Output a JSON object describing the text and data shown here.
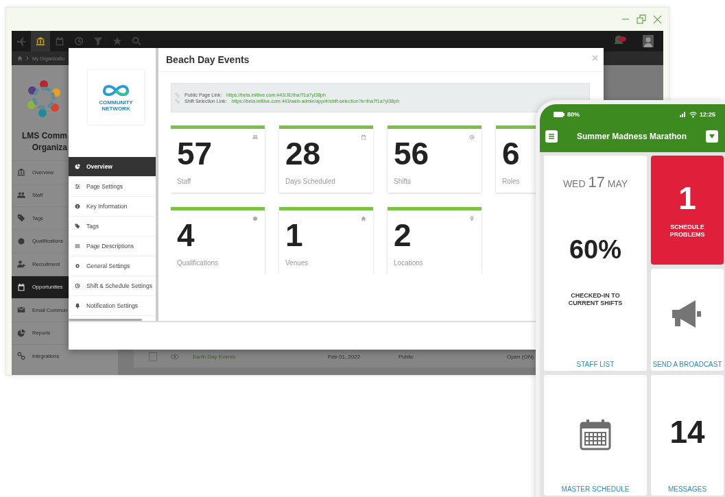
{
  "top_bar": {
    "icons": [
      {
        "kind": "plane",
        "selected": false
      },
      {
        "kind": "bank",
        "selected": true
      },
      {
        "kind": "calendar",
        "selected": false
      },
      {
        "kind": "clock",
        "selected": false
      },
      {
        "kind": "filter",
        "selected": false
      },
      {
        "kind": "star",
        "selected": false
      },
      {
        "kind": "search",
        "selected": false
      }
    ]
  },
  "breadcrumb": {
    "current": "My Organizatio"
  },
  "sidebar": {
    "org_name": [
      "LMS Comm",
      "Organiza"
    ],
    "items": [
      {
        "label": "Overview",
        "kind": "bank",
        "selected": false
      },
      {
        "label": "Staff",
        "kind": "people",
        "selected": false
      },
      {
        "label": "Tags",
        "kind": "tag",
        "selected": false
      },
      {
        "label": "Qualifications",
        "kind": "dot",
        "selected": false
      },
      {
        "label": "Recruitment",
        "kind": "person-add",
        "selected": false
      },
      {
        "label": "Opportunities",
        "kind": "calendar",
        "selected": true
      },
      {
        "label": "Email Commun",
        "kind": "mail",
        "selected": false
      },
      {
        "label": "Reports",
        "kind": "pie",
        "selected": false
      },
      {
        "label": "Integrations",
        "kind": "link",
        "selected": false
      }
    ]
  },
  "table": {
    "rows": [
      {
        "checked": false,
        "name": "Earth Day Events",
        "date": "Feb 01, 2022",
        "visibility": "Public",
        "status": "Open (ON)"
      }
    ]
  },
  "modal": {
    "title": "Beach Day Events",
    "logo_text": "COMMUNITY NETWORK",
    "nav": [
      {
        "label": "Overview",
        "kind": "pie",
        "selected": true
      },
      {
        "label": "Page Settings",
        "kind": "sliders",
        "selected": false
      },
      {
        "label": "Key Information",
        "kind": "info",
        "selected": false
      },
      {
        "label": "Tags",
        "kind": "tag",
        "selected": false
      },
      {
        "label": "Page Descriptions",
        "kind": "lines",
        "selected": false
      },
      {
        "label": "General Settings",
        "kind": "gear",
        "selected": false
      },
      {
        "label": "Shift & Schedule Settings",
        "kind": "clock",
        "selected": false
      },
      {
        "label": "Notification Settings",
        "kind": "bell",
        "selected": false
      }
    ],
    "links": [
      {
        "label": "Public Page Link:",
        "url": "https://beta.initlive.com:443/JE/tha7f1a7yl38ph"
      },
      {
        "label": "Shift Selection Link:",
        "url": "https://beta.initlive.com:443/web-admin/app/#/shift-selection?k=tha7f1a7yl38ph"
      }
    ],
    "stats": [
      {
        "value": "57",
        "label": "Staff",
        "kind": "people"
      },
      {
        "value": "28",
        "label": "Days Scheduled",
        "kind": "calendar"
      },
      {
        "value": "56",
        "label": "Shifts",
        "kind": "clock"
      },
      {
        "value": "6",
        "label": "Roles",
        "kind": "none"
      },
      {
        "value": "4",
        "label": "Qualifications",
        "kind": "dot"
      },
      {
        "value": "1",
        "label": "Venues",
        "kind": "home"
      },
      {
        "value": "2",
        "label": "Locations",
        "kind": "pin"
      }
    ]
  },
  "phone": {
    "battery": "80%",
    "time": "12:25",
    "title": "Summer Madness Marathon",
    "tiles": [
      {
        "kind": "checkin",
        "weekday": "WED",
        "day": "17",
        "month": "MAY",
        "value": "60%",
        "caption": "CHECKED-IN TO CURRENT SHIFTS",
        "link": "STAFF LIST"
      },
      {
        "kind": "problems",
        "value": "1",
        "caption": "SCHEDULE PROBLEMS"
      },
      {
        "kind": "broadcast",
        "link": "SEND A BROADCAST"
      },
      {
        "kind": "schedule",
        "link": "MASTER SCHEDULE"
      },
      {
        "kind": "messages",
        "value": "14",
        "link": "MESSAGES"
      }
    ]
  }
}
